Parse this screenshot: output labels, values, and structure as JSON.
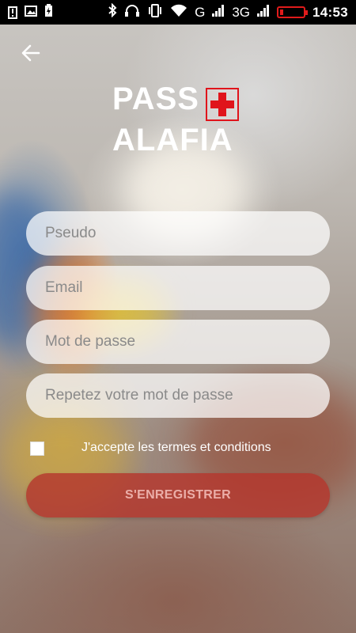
{
  "status_bar": {
    "network_label": "G",
    "network2_label": "3G",
    "time": "14:53",
    "icons": [
      "alert-icon",
      "image-icon",
      "battery-charging-icon",
      "bluetooth-icon",
      "headphones-icon",
      "vibrate-icon",
      "wifi-icon",
      "signal-icon",
      "battery-icon"
    ]
  },
  "header": {
    "back_icon": "arrow-left-icon"
  },
  "logo": {
    "line1": "PASS",
    "line2": "ALAFIA",
    "cross_color": "#e0141b"
  },
  "form": {
    "pseudo_placeholder": "Pseudo",
    "email_placeholder": "Email",
    "password_placeholder": "Mot de passe",
    "repeat_password_placeholder": "Repetez votre mot de passe",
    "pseudo_value": "",
    "email_value": "",
    "password_value": "",
    "repeat_password_value": "",
    "terms_label": "J'accepte les termes et conditions",
    "terms_checked": false,
    "register_label": "S'ENREGISTRER",
    "accent_color": "#b4372d"
  }
}
